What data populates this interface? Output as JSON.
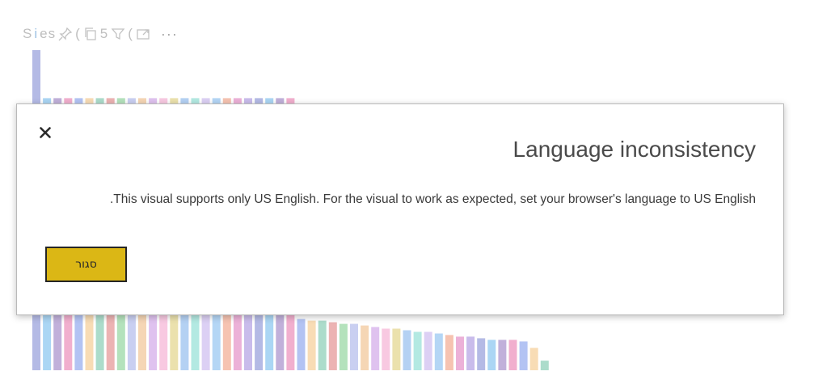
{
  "visual_header": {
    "title_fragments": [
      "S",
      "i",
      "es",
      "(",
      "5",
      "("
    ],
    "icons": [
      "pin-icon",
      "copy-icon",
      "filter-icon",
      "focus-mode-icon",
      "more-options-icon"
    ],
    "more_label": "···"
  },
  "dialog": {
    "title": "Language inconsistency",
    "message": "This visual supports only US English. For the visual to work as expected, set your browser's language to US English.",
    "close_button_label": "סגור",
    "button_color": "#dbb715"
  },
  "chart_data": {
    "type": "bar",
    "values": [
      100,
      85,
      85,
      85,
      85,
      85,
      85,
      85,
      85,
      85,
      85,
      85,
      85,
      85,
      85,
      85,
      85,
      85,
      85,
      85,
      85,
      85,
      85,
      85,
      85,
      16,
      15.5,
      15.5,
      15,
      14.5,
      14.5,
      14,
      13.5,
      13,
      13,
      12.5,
      12,
      12,
      11.5,
      11,
      10.5,
      10.5,
      10,
      9.5,
      9.5,
      9.5,
      9,
      7,
      3
    ],
    "colors": [
      "#a7aee0",
      "#9ccff2",
      "#b6a2d4",
      "#eea1c5",
      "#a6b8f1",
      "#f7d6a8",
      "#9ed6c2",
      "#e9a6a6",
      "#a7ddb0",
      "#bfc7ef",
      "#f3cfa8",
      "#d9b7ec",
      "#f7c0dc",
      "#e8dc9f",
      "#a7c9f1",
      "#a6e5dd",
      "#d6c8f2",
      "#a7cff3",
      "#f4b9a3",
      "#e9a3d1",
      "#c0b0e8"
    ],
    "grid": false
  }
}
